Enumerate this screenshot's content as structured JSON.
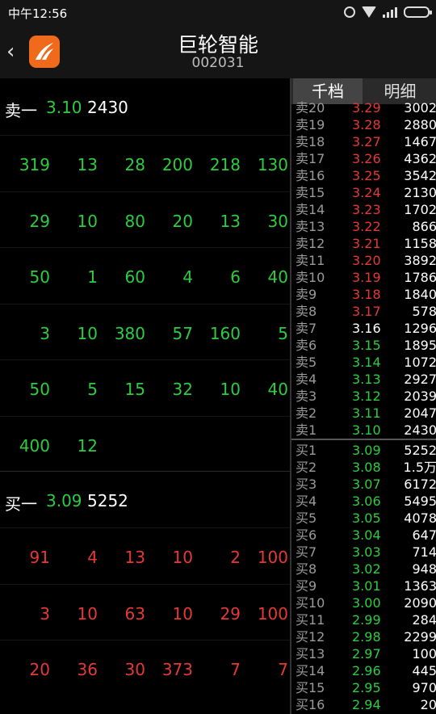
{
  "status": {
    "time": "中午12:56"
  },
  "header": {
    "title": "巨轮智能",
    "code": "002031",
    "back_glyph": "‹"
  },
  "left": {
    "sell": {
      "label": "卖一",
      "price": "3.10",
      "volume": "2430",
      "rows": [
        [
          "319",
          "13",
          "28",
          "200",
          "218",
          "130"
        ],
        [
          "29",
          "10",
          "80",
          "20",
          "13",
          "30"
        ],
        [
          "50",
          "1",
          "60",
          "4",
          "6",
          "40"
        ],
        [
          "3",
          "10",
          "380",
          "57",
          "160",
          "5"
        ],
        [
          "50",
          "5",
          "15",
          "32",
          "10",
          "40"
        ],
        [
          "400",
          "12",
          "",
          "",
          "",
          ""
        ]
      ]
    },
    "buy": {
      "label": "买一",
      "price": "3.09",
      "volume": "5252",
      "rows": [
        [
          "91",
          "4",
          "13",
          "10",
          "2",
          "100"
        ],
        [
          "3",
          "10",
          "63",
          "10",
          "29",
          "100"
        ],
        [
          "20",
          "36",
          "30",
          "373",
          "7",
          "7"
        ]
      ]
    }
  },
  "right": {
    "tabs": [
      "千档",
      "明细"
    ],
    "sell_rows": [
      {
        "label": "卖20",
        "price": "3.29",
        "vol": "3002",
        "color": "red"
      },
      {
        "label": "卖19",
        "price": "3.28",
        "vol": "2880",
        "color": "red"
      },
      {
        "label": "卖18",
        "price": "3.27",
        "vol": "1467",
        "color": "red"
      },
      {
        "label": "卖17",
        "price": "3.26",
        "vol": "4362",
        "color": "red"
      },
      {
        "label": "卖16",
        "price": "3.25",
        "vol": "3542",
        "color": "red"
      },
      {
        "label": "卖15",
        "price": "3.24",
        "vol": "2130",
        "color": "red"
      },
      {
        "label": "卖14",
        "price": "3.23",
        "vol": "1702",
        "color": "red"
      },
      {
        "label": "卖13",
        "price": "3.22",
        "vol": "866",
        "color": "red"
      },
      {
        "label": "卖12",
        "price": "3.21",
        "vol": "1158",
        "color": "red"
      },
      {
        "label": "卖11",
        "price": "3.20",
        "vol": "3892",
        "color": "red"
      },
      {
        "label": "卖10",
        "price": "3.19",
        "vol": "1786",
        "color": "red"
      },
      {
        "label": "卖9",
        "price": "3.18",
        "vol": "1840",
        "color": "red"
      },
      {
        "label": "卖8",
        "price": "3.17",
        "vol": "578",
        "color": "red"
      },
      {
        "label": "卖7",
        "price": "3.16",
        "vol": "1296",
        "color": "white"
      },
      {
        "label": "卖6",
        "price": "3.15",
        "vol": "1895",
        "color": "green"
      },
      {
        "label": "卖5",
        "price": "3.14",
        "vol": "1072",
        "color": "green"
      },
      {
        "label": "卖4",
        "price": "3.13",
        "vol": "2927",
        "color": "green"
      },
      {
        "label": "卖3",
        "price": "3.12",
        "vol": "2039",
        "color": "green"
      },
      {
        "label": "卖2",
        "price": "3.11",
        "vol": "2047",
        "color": "green"
      },
      {
        "label": "卖1",
        "price": "3.10",
        "vol": "2430",
        "color": "green"
      }
    ],
    "buy_rows": [
      {
        "label": "买1",
        "price": "3.09",
        "vol": "5252",
        "color": "green"
      },
      {
        "label": "买2",
        "price": "3.08",
        "vol": "1.5万",
        "color": "green"
      },
      {
        "label": "买3",
        "price": "3.07",
        "vol": "6172",
        "color": "green"
      },
      {
        "label": "买4",
        "price": "3.06",
        "vol": "5495",
        "color": "green"
      },
      {
        "label": "买5",
        "price": "3.05",
        "vol": "4078",
        "color": "green"
      },
      {
        "label": "买6",
        "price": "3.04",
        "vol": "647",
        "color": "green"
      },
      {
        "label": "买7",
        "price": "3.03",
        "vol": "714",
        "color": "green"
      },
      {
        "label": "买8",
        "price": "3.02",
        "vol": "948",
        "color": "green"
      },
      {
        "label": "买9",
        "price": "3.01",
        "vol": "1363",
        "color": "green"
      },
      {
        "label": "买10",
        "price": "3.00",
        "vol": "2090",
        "color": "green"
      },
      {
        "label": "买11",
        "price": "2.99",
        "vol": "284",
        "color": "green"
      },
      {
        "label": "买12",
        "price": "2.98",
        "vol": "2299",
        "color": "green"
      },
      {
        "label": "买13",
        "price": "2.97",
        "vol": "100",
        "color": "green"
      },
      {
        "label": "买14",
        "price": "2.96",
        "vol": "445",
        "color": "green"
      },
      {
        "label": "买15",
        "price": "2.95",
        "vol": "970",
        "color": "green"
      },
      {
        "label": "买16",
        "price": "2.94",
        "vol": "20",
        "color": "green"
      }
    ]
  },
  "colors": {
    "green": "#2ecc40",
    "red": "#e53935",
    "white": "#ffffff",
    "logo": "#ef6a1b"
  }
}
